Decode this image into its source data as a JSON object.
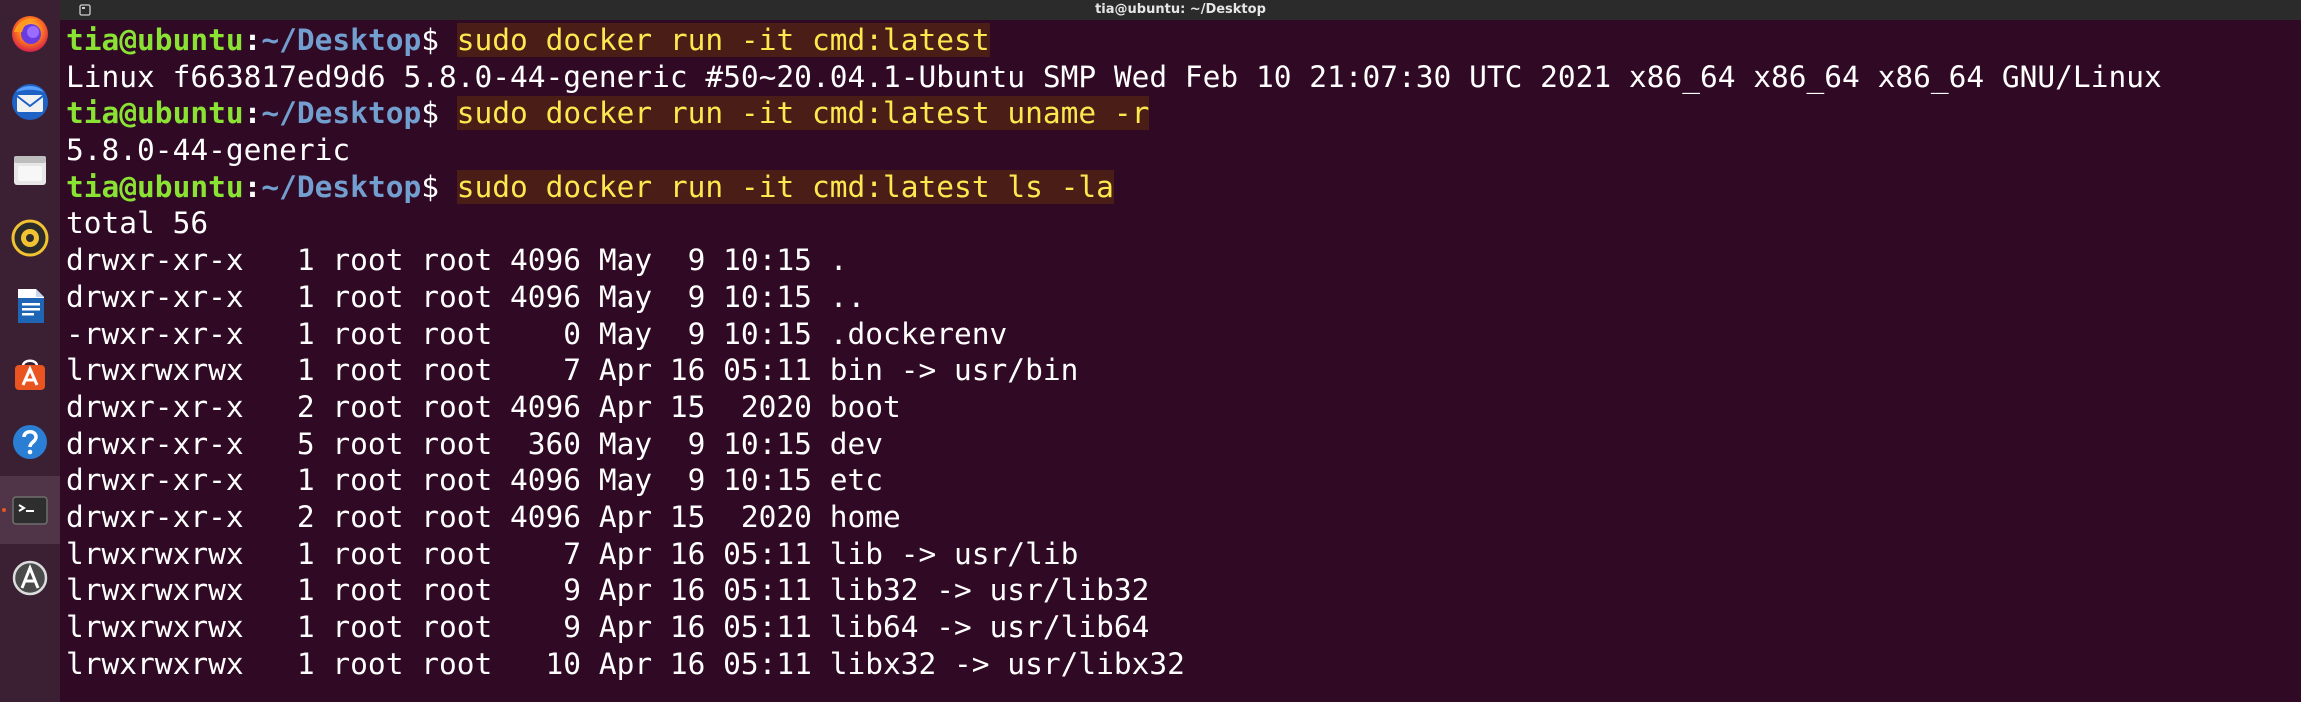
{
  "window": {
    "title": "tia@ubuntu: ~/Desktop"
  },
  "dock": {
    "items": [
      {
        "name": "firefox"
      },
      {
        "name": "thunderbird"
      },
      {
        "name": "files"
      },
      {
        "name": "rhythmbox"
      },
      {
        "name": "libreoffice-writer"
      },
      {
        "name": "ubuntu-software"
      },
      {
        "name": "help"
      },
      {
        "name": "terminal",
        "active": true
      },
      {
        "name": "software-updater"
      }
    ]
  },
  "prompt": {
    "user_host": "tia@ubuntu",
    "colon": ":",
    "path": "~/Desktop",
    "symbol": "$"
  },
  "terminal": {
    "lines": [
      {
        "type": "prompt",
        "command": "sudo docker run -it cmd:latest"
      },
      {
        "type": "output",
        "text": "Linux f663817ed9d6 5.8.0-44-generic #50~20.04.1-Ubuntu SMP Wed Feb 10 21:07:30 UTC 2021 x86_64 x86_64 x86_64 GNU/Linux"
      },
      {
        "type": "prompt",
        "command": "sudo docker run -it cmd:latest uname -r"
      },
      {
        "type": "output",
        "text": "5.8.0-44-generic"
      },
      {
        "type": "prompt",
        "command": "sudo docker run -it cmd:latest ls -la"
      },
      {
        "type": "output",
        "text": "total 56"
      },
      {
        "type": "output",
        "text": "drwxr-xr-x   1 root root 4096 May  9 10:15 ."
      },
      {
        "type": "output",
        "text": "drwxr-xr-x   1 root root 4096 May  9 10:15 .."
      },
      {
        "type": "output",
        "text": "-rwxr-xr-x   1 root root    0 May  9 10:15 .dockerenv"
      },
      {
        "type": "output",
        "text": "lrwxrwxrwx   1 root root    7 Apr 16 05:11 bin -> usr/bin"
      },
      {
        "type": "output",
        "text": "drwxr-xr-x   2 root root 4096 Apr 15  2020 boot"
      },
      {
        "type": "output",
        "text": "drwxr-xr-x   5 root root  360 May  9 10:15 dev"
      },
      {
        "type": "output",
        "text": "drwxr-xr-x   1 root root 4096 May  9 10:15 etc"
      },
      {
        "type": "output",
        "text": "drwxr-xr-x   2 root root 4096 Apr 15  2020 home"
      },
      {
        "type": "output",
        "text": "lrwxrwxrwx   1 root root    7 Apr 16 05:11 lib -> usr/lib"
      },
      {
        "type": "output",
        "text": "lrwxrwxrwx   1 root root    9 Apr 16 05:11 lib32 -> usr/lib32"
      },
      {
        "type": "output",
        "text": "lrwxrwxrwx   1 root root    9 Apr 16 05:11 lib64 -> usr/lib64"
      },
      {
        "type": "output",
        "text": "lrwxrwxrwx   1 root root   10 Apr 16 05:11 libx32 -> usr/libx32"
      }
    ]
  },
  "colors": {
    "terminal_bg": "#300a24",
    "prompt_user": "#8ae234",
    "prompt_path": "#729fcf",
    "command_text": "#fce94f",
    "command_highlight": "#4a1e17",
    "dock_bg": "#3b1f33",
    "titlebar_bg": "#2b2b2b",
    "accent": "#e95420"
  }
}
